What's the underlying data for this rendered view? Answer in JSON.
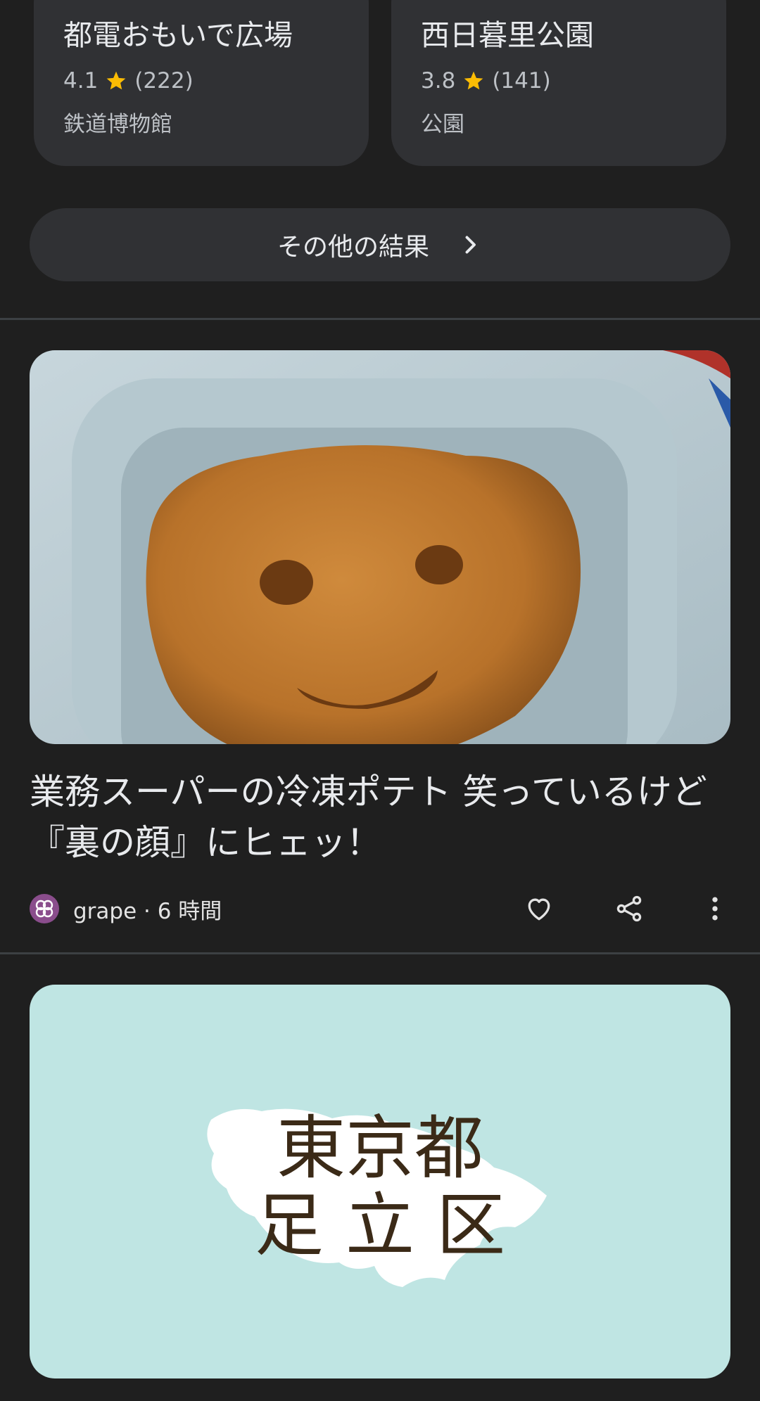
{
  "places": [
    {
      "name": "都電おもいで広場",
      "rating": "4.1",
      "reviews": "(222)",
      "category": "鉄道博物館"
    },
    {
      "name": "西日暮里公園",
      "rating": "3.8",
      "reviews": "(141)",
      "category": "公園"
    }
  ],
  "more_results_label": "その他の結果",
  "article": {
    "title": "業務スーパーの冷凍ポテト 笑っているけど『裏の顔』にヒェッ！",
    "source": "grape",
    "time": "6 時間",
    "meta": "grape · 6 時間"
  },
  "map_card": {
    "line1": "東京都",
    "line2": "足 立 区"
  },
  "colors": {
    "background": "#1f1f1f",
    "card": "#303134",
    "star": "#fbbc04",
    "map_bg": "#bfe5e3",
    "map_text": "#3b2a17"
  },
  "icons": [
    "star-icon",
    "chevron-right-icon",
    "heart-icon",
    "share-icon",
    "more-vert-icon",
    "grape-logo-icon"
  ]
}
